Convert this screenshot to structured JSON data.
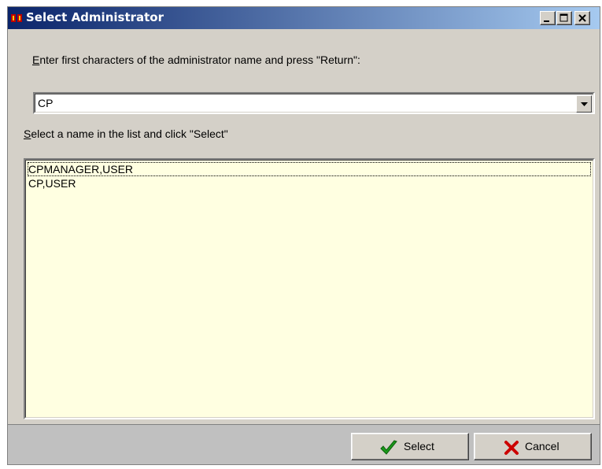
{
  "window": {
    "title": "Select Administrator",
    "controls": {
      "minimize": "minimize-icon",
      "maximize": "maximize-icon",
      "close": "close-icon"
    }
  },
  "search": {
    "label_accel": "E",
    "label_rest": "nter first characters of the administrator name and press \"Return\":",
    "value": "CP"
  },
  "list": {
    "label_accel": "S",
    "label_rest": "elect a name in the list and click \"Select\"",
    "items": [
      "CPMANAGER,USER",
      "CP,USER"
    ],
    "focused_index": 0
  },
  "buttons": {
    "select_label": "Select",
    "select_icon": "checkmark-icon",
    "cancel_label": "Cancel",
    "cancel_icon": "x-icon"
  },
  "colors": {
    "title_gradient_start": "#0a246a",
    "title_gradient_end": "#a6caf0",
    "list_background": "#ffffe1",
    "check_green": "#1a9a1a",
    "cancel_red": "#cc0000"
  }
}
